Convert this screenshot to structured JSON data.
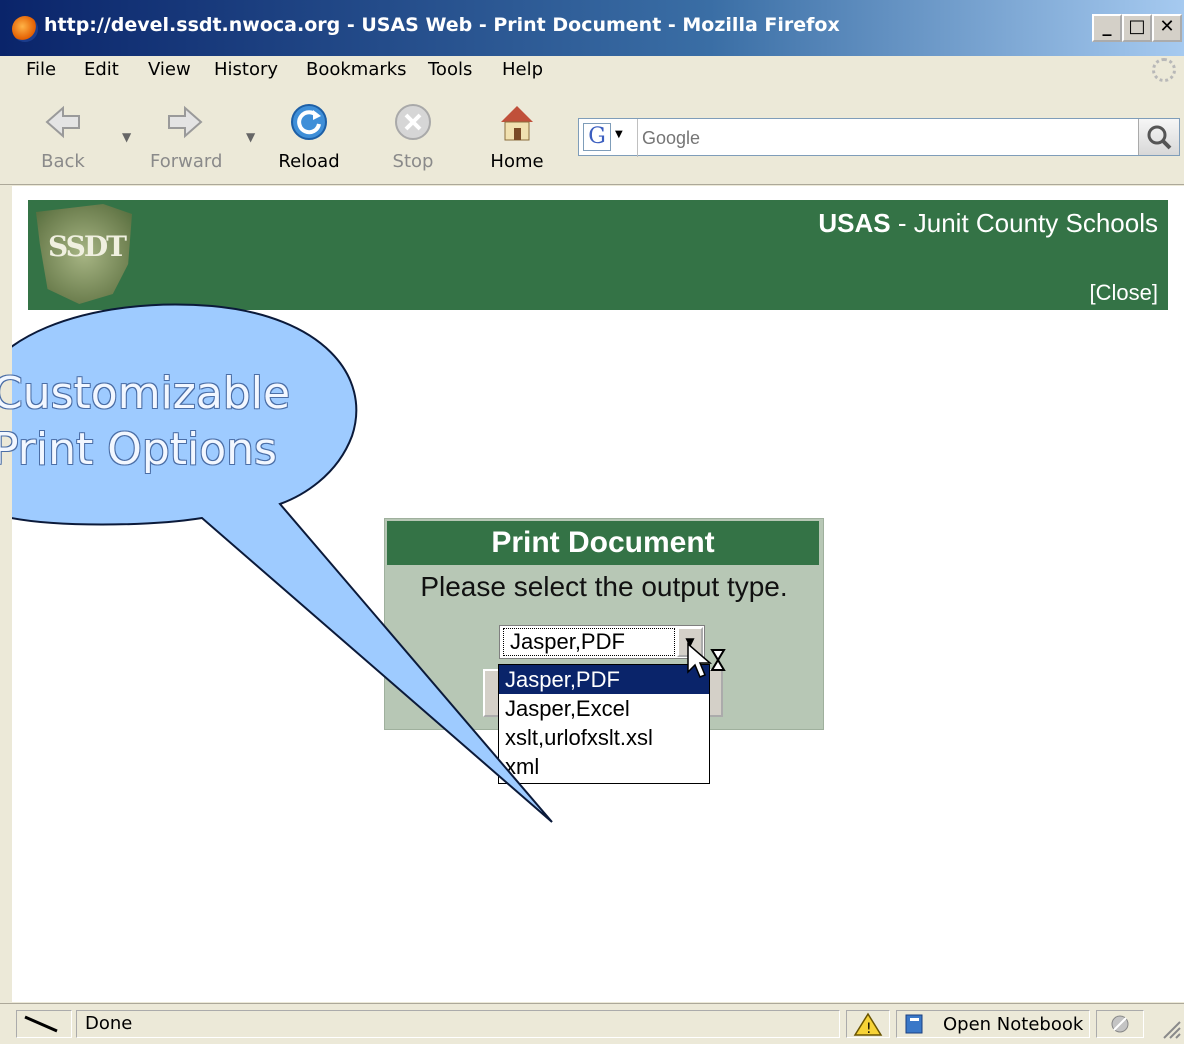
{
  "window": {
    "title": "http://devel.ssdt.nwoca.org - USAS Web - Print Document - Mozilla Firefox",
    "minimize": "_",
    "maximize": "□",
    "close": "✕"
  },
  "menu": [
    {
      "label": "File"
    },
    {
      "label": "Edit"
    },
    {
      "label": "View"
    },
    {
      "label": "History"
    },
    {
      "label": "Bookmarks"
    },
    {
      "label": "Tools"
    },
    {
      "label": "Help"
    }
  ],
  "toolbar": {
    "back": "Back",
    "forward": "Forward",
    "reload": "Reload",
    "stop": "Stop",
    "home": "Home",
    "search_placeholder": "Google",
    "search_engine": "G"
  },
  "header": {
    "app_name": "USAS",
    "org": " - Junit County Schools",
    "close_link": "[Close]",
    "logo_text": "SSDT"
  },
  "print_dialog": {
    "title": "Print Document",
    "prompt": "Please select the output type.",
    "selected": "Jasper,PDF",
    "options": [
      "Jasper,PDF",
      "Jasper,Excel",
      "xslt,urlofxslt.xsl",
      "xml"
    ]
  },
  "callout": {
    "line1": "Customizable",
    "line2": "Print Options"
  },
  "status": {
    "text": "Done",
    "notebook": "Open Notebook"
  },
  "colors": {
    "header_green": "#347346",
    "panel_bg": "#b7c7b5",
    "selection_blue": "#0a246a",
    "callout_fill": "#9ecbff"
  }
}
